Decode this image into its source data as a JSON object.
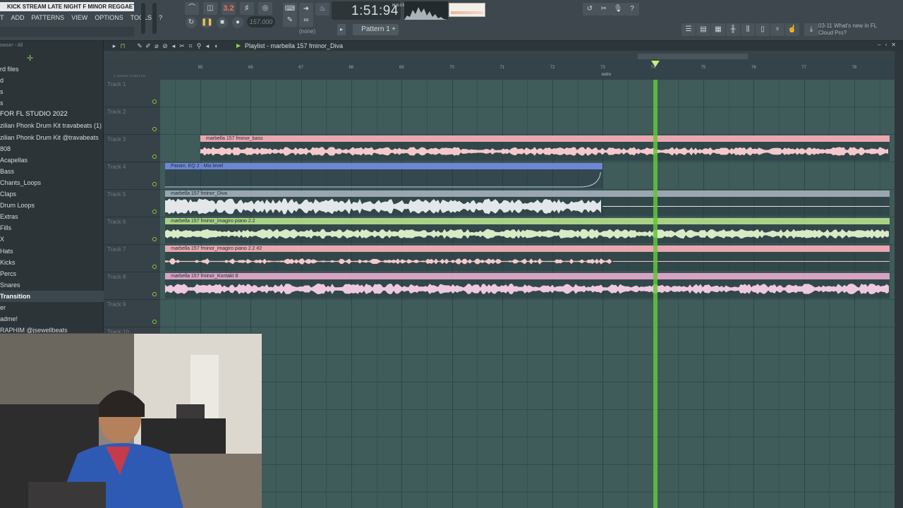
{
  "project_title": "KICK STREAM LATE NIGHT F MINOR REGGAETO",
  "menu": [
    "T",
    "ADD",
    "PATTERNS",
    "VIEW",
    "OPTIONS",
    "TOOLS",
    "?"
  ],
  "transport": {
    "song_position": "1:51:94",
    "position_unit": "M:S:CS",
    "tempo": "157.000",
    "pattern": "Pattern 1",
    "none_label": "(none)",
    "counter_value": "3.2"
  },
  "news": {
    "line1": "03-11  What's new in FL",
    "line2": "Cloud Pro?"
  },
  "browser": {
    "header": "owser - All",
    "items": [
      {
        "label": "rd files",
        "section": false,
        "selected": false
      },
      {
        "label": "d",
        "section": false,
        "selected": false
      },
      {
        "label": "s",
        "section": false,
        "selected": false
      },
      {
        "label": "s",
        "section": false,
        "selected": false
      },
      {
        "label": " FOR FL STUDIO 2022",
        "section": true,
        "selected": false
      },
      {
        "label": "zilian Phonk Drum Kit travabeats (1)",
        "section": false,
        "selected": false
      },
      {
        "label": "zilian Phonk Drum Kit @travabeats",
        "section": false,
        "selected": false
      },
      {
        "label": "808",
        "section": false,
        "selected": false
      },
      {
        "label": "Acapellas",
        "section": false,
        "selected": false
      },
      {
        "label": "Bass",
        "section": false,
        "selected": false
      },
      {
        "label": "Chants_Loops",
        "section": false,
        "selected": false
      },
      {
        "label": "Claps",
        "section": false,
        "selected": false
      },
      {
        "label": "Drum Loops",
        "section": false,
        "selected": false
      },
      {
        "label": "Extras",
        "section": false,
        "selected": false
      },
      {
        "label": "Fills",
        "section": false,
        "selected": false
      },
      {
        "label": "X",
        "section": false,
        "selected": false
      },
      {
        "label": "Hats",
        "section": false,
        "selected": false
      },
      {
        "label": "Kicks",
        "section": false,
        "selected": false
      },
      {
        "label": "Percs",
        "section": false,
        "selected": false
      },
      {
        "label": "Snares",
        "section": false,
        "selected": false
      },
      {
        "label": "Transition",
        "section": false,
        "selected": true
      },
      {
        "label": "er",
        "section": false,
        "selected": false
      },
      {
        "label": "adme!",
        "section": false,
        "selected": false
      },
      {
        "label": "RAPHIM @jsewellbeats",
        "section": false,
        "selected": false
      }
    ]
  },
  "playlist": {
    "title": "Playlist - marbella 157 fminor_Diva",
    "left_label": "Z-CROSS  STRETCH",
    "bars": [
      "65",
      "66",
      "67",
      "68",
      "69",
      "70",
      "71",
      "72",
      "73",
      "74",
      "75",
      "76",
      "77",
      "78"
    ],
    "marker": "outro",
    "tracks": [
      "Track 1",
      "Track 2",
      "Track 3",
      "Track 4",
      "Track 5",
      "Track 6",
      "Track 7",
      "Track 8",
      "Track 9",
      "Track 10"
    ],
    "clips": [
      {
        "track": 3,
        "name": "marbella 157 fminor_bass",
        "kind": "audio",
        "color": "#e9a8b0",
        "wave": "#f3c9cd",
        "start_bar": 65.0,
        "end_bar": 78.7,
        "density": 0.5
      },
      {
        "track": 4,
        "name": "Param. EQ 2 - Mix level",
        "kind": "automation",
        "color": "#6e86d6",
        "wave": "#c7d2f0",
        "start_bar": 64.3,
        "end_bar": 73.0
      },
      {
        "track": 5,
        "name": "marbella 157 fminor_Diva",
        "kind": "audio",
        "color": "#9aa7b0",
        "wave": "#e3e7ea",
        "start_bar": 64.3,
        "end_bar": 78.7,
        "audio_end_bar": 73.0,
        "density": 0.9
      },
      {
        "track": 6,
        "name": "marbella 157 fminor_imagiro piano 2.2",
        "kind": "audio",
        "color": "#a9d186",
        "wave": "#d8ebc6",
        "start_bar": 64.3,
        "end_bar": 78.7,
        "density": 0.55
      },
      {
        "track": 7,
        "name": "marbella 157 fminor_imagiro piano 2.2 #2",
        "kind": "audio",
        "color": "#e9a8b0",
        "wave": "#f3c9cd",
        "start_bar": 64.3,
        "end_bar": 78.7,
        "audio_end_bar": 73.2,
        "density": 0.35
      },
      {
        "track": 8,
        "name": "marbella 157 fminor_Kontakt 8",
        "kind": "audio",
        "color": "#d7a2c6",
        "wave": "#edc9e0",
        "start_bar": 64.3,
        "end_bar": 78.7,
        "density": 0.6
      }
    ],
    "playhead_bar": 74.05
  },
  "colors": {
    "grid_bg": "#3f5b5a",
    "playhead": "#63c63a",
    "accent_green": "#8fd14f"
  }
}
